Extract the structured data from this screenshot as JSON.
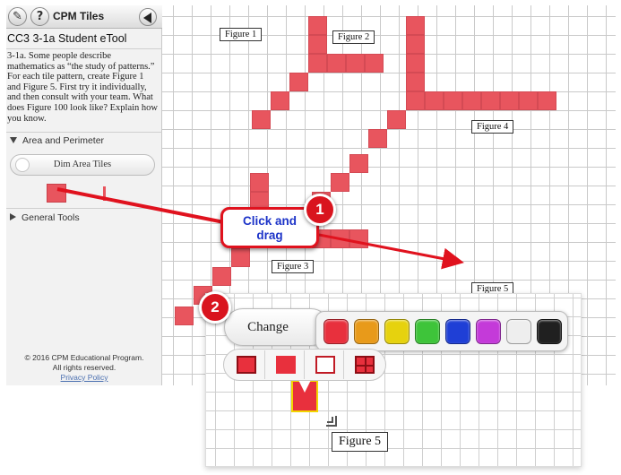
{
  "app": {
    "title": "CPM Tiles",
    "etool_title": "CC3 3-1a Student eTool",
    "problem_text": "3-1a. Some people describe mathematics as “the study of patterns.” For each tile pattern, create Figure 1 and Figure 5. First try it individually, and then consult with your team. What does Figure 100 look like? Explain how you know.",
    "help_symbol": "?"
  },
  "sidebar": {
    "area_section": "Area and Perimeter",
    "dim_button": "Dim Area Tiles",
    "general_section": "General Tools",
    "footer": {
      "copyright": "© 2016 CPM Educational Program.",
      "rights": "All rights reserved.",
      "privacy": "Privacy Policy"
    }
  },
  "canvas": {
    "labels": {
      "fig1": "Figure 1",
      "fig2": "Figure 2",
      "fig3": "Figure 3",
      "fig4": "Figure 4",
      "fig5": "Figure 5"
    }
  },
  "inset": {
    "figure_label": "Figure 5",
    "change_button": "Change",
    "palette": [
      "#e8303d",
      "#e89a1a",
      "#e6d20e",
      "#3ec43a",
      "#1f3fd6",
      "#c43ad9",
      "#eeeeee",
      "#202020"
    ],
    "palette_names": [
      "red",
      "orange",
      "yellow",
      "green",
      "blue",
      "purple",
      "white",
      "black"
    ],
    "tile_styles": [
      "filled-bordered",
      "filled",
      "outline",
      "divided"
    ]
  },
  "callouts": {
    "step1": "1",
    "step2": "2",
    "instruction_line1": "Click and",
    "instruction_line2": "drag"
  },
  "colors": {
    "tile": "#e8555e",
    "callout_red": "#e0121e",
    "callout_text": "#1c33c8"
  }
}
